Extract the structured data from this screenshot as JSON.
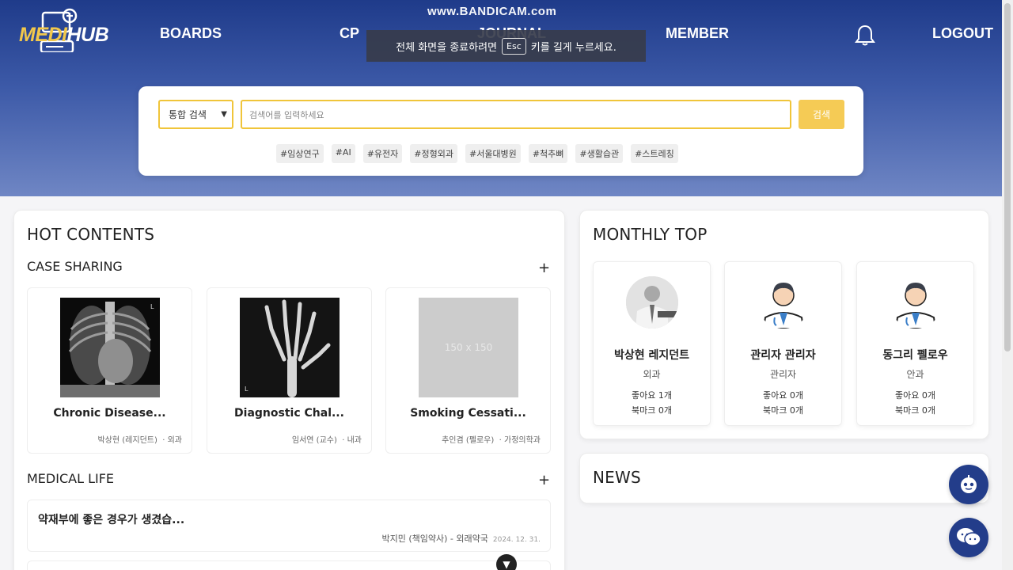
{
  "app": {
    "logo_medi": "MEDI",
    "logo_hub": "HUB"
  },
  "nav": {
    "boards": "BOARDS",
    "cp": "CP",
    "journal": "JOURNAL",
    "member": "MEMBER",
    "logout": "LOGOUT"
  },
  "overlay": {
    "recorder": "www.BANDICAM.com",
    "toast_before": "전체 화면을 종료하려면",
    "toast_key": "Esc",
    "toast_after": "키를 길게 누르세요."
  },
  "search": {
    "select_value": "통합 검색",
    "placeholder": "검색어를 입력하세요",
    "button": "검색",
    "tags": [
      "#임상연구",
      "#AI",
      "#유전자",
      "#정형외과",
      "#서울대병원",
      "#척추뼈",
      "#생활습관",
      "#스트레칭"
    ]
  },
  "hot": {
    "title": "HOT CONTENTS",
    "case_title": "CASE SHARING",
    "plus": "+",
    "cases": [
      {
        "title": "Chronic Disease...",
        "author": "박상현 (레지던트)",
        "dept": "· 외과"
      },
      {
        "title": "Diagnostic Chal...",
        "author": "임서연 (교수)",
        "dept": "· 내과"
      },
      {
        "title": "Smoking Cessati...",
        "author": "추인겸 (펠로우)",
        "dept": "· 가정의학과",
        "placeholder": "150 x 150"
      }
    ],
    "life_title": "MEDICAL LIFE",
    "life_items": [
      {
        "title": "약재부에 좋은 경우가 생겼습...",
        "author": "박지민 (책임약사) - 외래약국",
        "date": "2024. 12. 31."
      }
    ]
  },
  "monthly": {
    "title": "MONTHLY TOP",
    "items": [
      {
        "name": "박상현 레지던트",
        "dept": "외과",
        "likes": "좋아요 1개",
        "bookmarks": "북마크 0개"
      },
      {
        "name": "관리자 관리자",
        "dept": "관리자",
        "likes": "좋아요 0개",
        "bookmarks": "북마크 0개"
      },
      {
        "name": "동그리 펠로우",
        "dept": "안과",
        "likes": "좋아요 0개",
        "bookmarks": "북마크 0개"
      }
    ]
  },
  "news": {
    "title": "NEWS"
  },
  "colors": {
    "accent": "#f0c53a",
    "brand": "#233d8a"
  }
}
